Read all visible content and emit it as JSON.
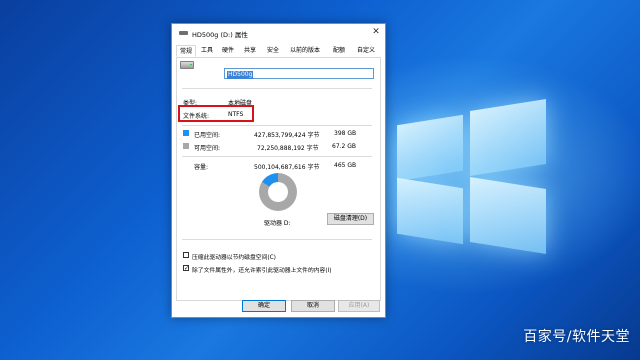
{
  "window": {
    "title": "HD500g (D:) 属性",
    "close_symbol": "✕",
    "tabs": [
      {
        "label": "常规",
        "active": true
      },
      {
        "label": "工具",
        "active": false
      },
      {
        "label": "硬件",
        "active": false
      },
      {
        "label": "共享",
        "active": false
      },
      {
        "label": "安全",
        "active": false
      },
      {
        "label": "以前的版本",
        "active": false
      },
      {
        "label": "配额",
        "active": false
      },
      {
        "label": "自定义",
        "active": false
      }
    ]
  },
  "general": {
    "drive_name": "HD500g",
    "type_label": "类型:",
    "type_value": "本地磁盘",
    "fs_label": "文件系统:",
    "fs_value": "NTFS",
    "used_label": "已用空间:",
    "used_bytes": "427,853,799,424 字节",
    "used_size": "398 GB",
    "free_label": "可用空间:",
    "free_bytes": "72,250,888,192 字节",
    "free_size": "67.2 GB",
    "capacity_label": "容量:",
    "capacity_bytes": "500,104,687,616 字节",
    "capacity_size": "465 GB",
    "drive_letter": "驱动器 D:",
    "cleanup_button": "磁盘清理(D)",
    "compress_label": "压缩此驱动器以节约磁盘空间(C)",
    "compress_checked": false,
    "index_label": "除了文件属性外，还允许索引此驱动器上文件的内容(I)",
    "index_checked": true,
    "check_mark": "✓"
  },
  "usage": {
    "used_fraction": 0.16,
    "used_color": "#1e90f0",
    "free_color": "#a8a8a8"
  },
  "buttons": {
    "ok": "确定",
    "cancel": "取消",
    "apply": "应用(A)"
  },
  "watermark": "百家号/软件天堂"
}
